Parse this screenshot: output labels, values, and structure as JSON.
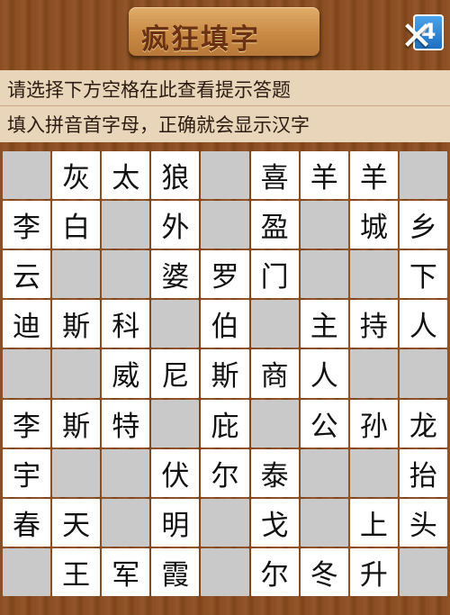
{
  "header": {
    "title": "疯狂填字",
    "level": "4",
    "close_glyph": "✕"
  },
  "hints": {
    "line1": "请选择下方空格在此查看提示答题",
    "line2": "填入拼音首字母，正确就会显示汉字"
  },
  "colors": {
    "filled_cell": "#ffffff",
    "blank_cell": "#c9c9c9",
    "wood": "#8a4e22",
    "hint_panel": "#e9d5b9",
    "level_badge": "#1f6fc0"
  },
  "board": {
    "rows": [
      [
        "",
        "灰",
        "太",
        "狼",
        "",
        "喜",
        "羊",
        "羊",
        ""
      ],
      [
        "李",
        "白",
        "",
        "外",
        "",
        "盈",
        "",
        "城",
        "乡"
      ],
      [
        "云",
        "",
        "",
        "婆",
        "罗",
        "门",
        "",
        "",
        "下"
      ],
      [
        "迪",
        "斯",
        "科",
        "",
        "伯",
        "",
        "主",
        "持",
        "人"
      ],
      [
        "",
        "",
        "威",
        "尼",
        "斯",
        "商",
        "人",
        "",
        ""
      ],
      [
        "李",
        "斯",
        "特",
        "",
        "庇",
        "",
        "公",
        "孙",
        "龙"
      ],
      [
        "宇",
        "",
        "",
        "伏",
        "尔",
        "泰",
        "",
        "",
        "抬"
      ],
      [
        "春",
        "天",
        "",
        "明",
        "",
        "戈",
        "",
        "上",
        "头"
      ],
      [
        "",
        "王",
        "军",
        "霞",
        "",
        "尔",
        "冬",
        "升",
        ""
      ]
    ]
  }
}
